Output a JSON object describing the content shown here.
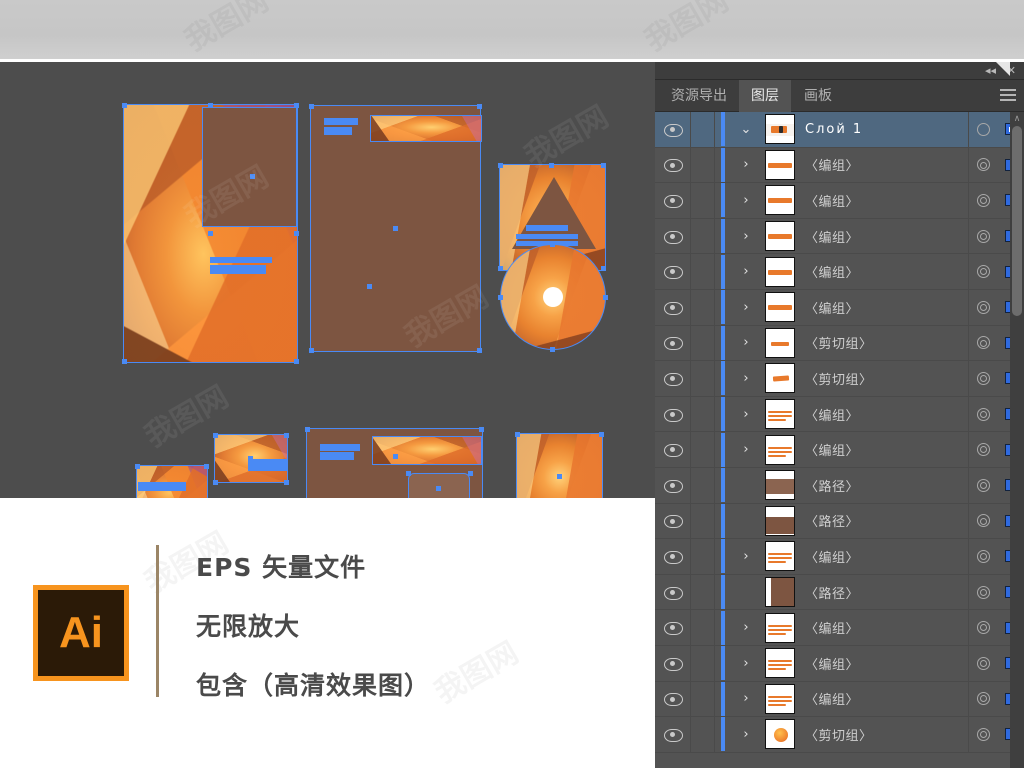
{
  "window": {
    "collapse_icon": "◂◂",
    "close_icon": "✕"
  },
  "panel": {
    "tabs": [
      {
        "label": "资源导出",
        "active": false
      },
      {
        "label": "图层",
        "active": true
      },
      {
        "label": "画板",
        "active": false
      }
    ],
    "menu_icon": "hamburger-menu-icon",
    "scroll_up_icon": "∧"
  },
  "layers": [
    {
      "name": "Слой 1",
      "selected": true,
      "expandable": true,
      "twisty": "⌄",
      "thumb": "logo",
      "target": "single"
    },
    {
      "name": "〈编组〉",
      "selected": false,
      "expandable": true,
      "twisty": "›",
      "thumb": "sample",
      "target": "double"
    },
    {
      "name": "〈编组〉",
      "selected": false,
      "expandable": true,
      "twisty": "›",
      "thumb": "sample",
      "target": "double"
    },
    {
      "name": "〈编组〉",
      "selected": false,
      "expandable": true,
      "twisty": "›",
      "thumb": "sample",
      "target": "double"
    },
    {
      "name": "〈编组〉",
      "selected": false,
      "expandable": true,
      "twisty": "›",
      "thumb": "sample",
      "target": "double"
    },
    {
      "name": "〈编组〉",
      "selected": false,
      "expandable": true,
      "twisty": "›",
      "thumb": "sample",
      "target": "double"
    },
    {
      "name": "〈剪切组〉",
      "selected": false,
      "expandable": true,
      "twisty": "›",
      "thumb": "bar",
      "target": "double"
    },
    {
      "name": "〈剪切组〉",
      "selected": false,
      "expandable": true,
      "twisty": "›",
      "thumb": "bar2",
      "target": "double"
    },
    {
      "name": "〈编组〉",
      "selected": false,
      "expandable": true,
      "twisty": "›",
      "thumb": "lines",
      "target": "double"
    },
    {
      "name": "〈编组〉",
      "selected": false,
      "expandable": true,
      "twisty": "›",
      "thumb": "lines",
      "target": "double"
    },
    {
      "name": "〈路径〉",
      "selected": false,
      "expandable": false,
      "twisty": "",
      "thumb": "brownband",
      "target": "double"
    },
    {
      "name": "〈路径〉",
      "selected": false,
      "expandable": false,
      "twisty": "",
      "thumb": "brownband2",
      "target": "double"
    },
    {
      "name": "〈编组〉",
      "selected": false,
      "expandable": true,
      "twisty": "›",
      "thumb": "lines",
      "target": "double"
    },
    {
      "name": "〈路径〉",
      "selected": false,
      "expandable": false,
      "twisty": "",
      "thumb": "brownblock",
      "target": "double"
    },
    {
      "name": "〈编组〉",
      "selected": false,
      "expandable": true,
      "twisty": "›",
      "thumb": "lines",
      "target": "double"
    },
    {
      "name": "〈编组〉",
      "selected": false,
      "expandable": true,
      "twisty": "›",
      "thumb": "lines",
      "target": "double"
    },
    {
      "name": "〈编组〉",
      "selected": false,
      "expandable": true,
      "twisty": "›",
      "thumb": "lines",
      "target": "double"
    },
    {
      "name": "〈剪切组〉",
      "selected": false,
      "expandable": true,
      "twisty": "›",
      "thumb": "disc",
      "target": "double"
    }
  ],
  "promo": {
    "logo_text": "Ai",
    "lines": [
      "EPS 矢量文件",
      "无限放大",
      "包含（高清效果图）"
    ]
  },
  "colors": {
    "accent_blue": "#4a8af4",
    "brand_orange": "#f7941e",
    "artwork_brown": "#7d5541",
    "panel_bg": "#535353",
    "selected_row": "#4f6880"
  },
  "watermark_text": "我图网"
}
